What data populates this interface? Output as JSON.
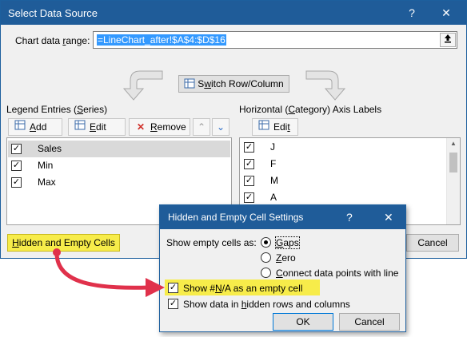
{
  "main": {
    "title": "Select Data Source",
    "help": "?",
    "close": "✕",
    "range_label_pre": "Chart data ",
    "range_label_ul": "r",
    "range_label_post": "ange:",
    "range_value": "=LineChart_after!$A$4:$D$16",
    "switch_pre": "S",
    "switch_ul": "w",
    "switch_post": "itch Row/Column",
    "legend_title_pre": "Legend Entries (",
    "legend_title_ul": "S",
    "legend_title_post": "eries)",
    "add_ul": "A",
    "add_post": "dd",
    "edit_ul": "E",
    "edit_post": "dit",
    "remove_ul": "R",
    "remove_post": "emove",
    "axis_title_pre": "Horizontal (",
    "axis_title_ul": "C",
    "axis_title_post": "ategory) Axis Labels",
    "axis_edit_pre": "Edi",
    "axis_edit_ul": "t",
    "series": [
      "Sales",
      "Min",
      "Max"
    ],
    "categories": [
      "J",
      "F",
      "M",
      "A"
    ],
    "hidden_ul": "H",
    "hidden_post": "idden and Empty Cells",
    "cancel": "Cancel"
  },
  "sub": {
    "title": "Hidden and Empty Cell Settings",
    "help": "?",
    "close": "✕",
    "show_empty": "Show empty cells as:",
    "gaps_ul": "G",
    "gaps_post": "aps",
    "zero_ul": "Z",
    "zero_post": "ero",
    "connect_ul": "C",
    "connect_post": "onnect data points with line",
    "na_pre": "Show #",
    "na_ul": "N",
    "na_post": "/A as an empty cell",
    "hidden_pre": "Show data in ",
    "hidden_ul": "h",
    "hidden_post": "idden rows and columns",
    "ok": "OK",
    "cancel": "Cancel"
  },
  "colors": {
    "titlebar": "#1f5c99",
    "highlight": "#f7ec4a",
    "arrow": "#e0314b",
    "selection": "#3399ff"
  }
}
